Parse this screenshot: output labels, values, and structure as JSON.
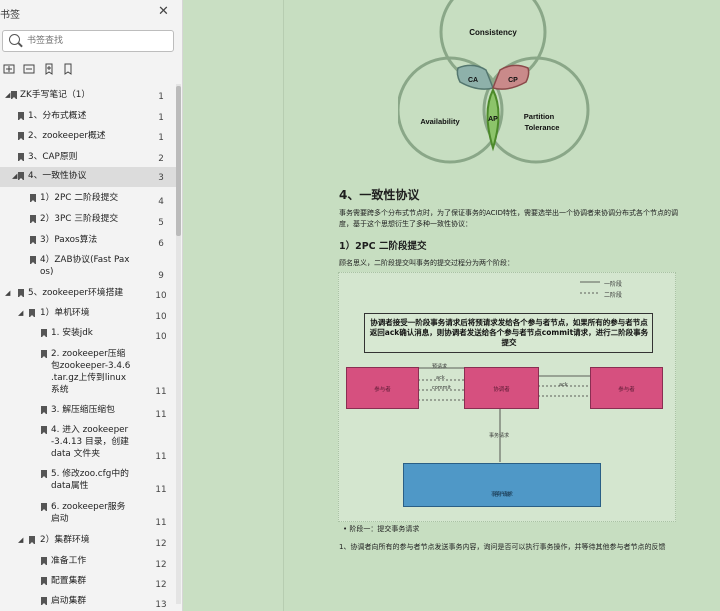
{
  "sidebar": {
    "title": "书签",
    "search_placeholder": "书签查找",
    "items": [
      {
        "label": "ZK手写笔记（1）",
        "page": "1"
      },
      {
        "label": "1、分布式概述",
        "page": "1"
      },
      {
        "label": "2、zookeeper概述",
        "page": "1"
      },
      {
        "label": "3、CAP原则",
        "page": "2"
      },
      {
        "label": "4、一致性协议",
        "page": "3"
      },
      {
        "label": "1）2PC 二阶段提交",
        "page": "4"
      },
      {
        "label": "2）3PC 三阶段提交",
        "page": "5"
      },
      {
        "label": "3）Paxos算法",
        "page": "6"
      },
      {
        "label": "4）ZAB协议(Fast Pax",
        "label2": "os)",
        "page": "9"
      },
      {
        "label": "5、zookeeper环境搭建",
        "page": "10"
      },
      {
        "label": "1）单机环境",
        "page": "10"
      },
      {
        "label": "1. 安装jdk",
        "page": "10"
      },
      {
        "label": "2. zookeeper压缩",
        "label2": "包zookeeper-3.4.6",
        "label3": ".tar.gz上传到linux",
        "label4": "系统",
        "page": "11"
      },
      {
        "label": "3. 解压缩压缩包",
        "page": "11"
      },
      {
        "label": "4. 进入 zookeeper",
        "label2": "-3.4.13 目录，创建",
        "label3": "data 文件夹",
        "page": "11"
      },
      {
        "label": "5. 修改zoo.cfg中的",
        "label2": "data属性",
        "page": "11"
      },
      {
        "label": "6. zookeeper服务",
        "label2": "启动",
        "page": "11"
      },
      {
        "label": "2）集群环境",
        "page": "12"
      },
      {
        "label": "准备工作",
        "page": "12"
      },
      {
        "label": "配置集群",
        "page": "12"
      },
      {
        "label": "启动集群",
        "page": "13"
      }
    ]
  },
  "venn": {
    "consistency": "Consistency",
    "availability": "Availability",
    "partition": "Partition",
    "tolerance": "Tolerance",
    "ca": "CA",
    "cp": "CP",
    "ap": "AP"
  },
  "doc": {
    "heading": "4、一致性协议",
    "para1": "事务需要跨多个分布式节点时，为了保证事务的ACID特性，需要选举出一个协调者来协调分布式各个节点的调度，基于这个思想衍生了多种一致性协议：",
    "sub1": "1）2PC 二阶段提交",
    "para2": "顾名思义，二阶段提交叫事务的提交过程分为两个阶段：",
    "legend1": "一阶段",
    "legend2": "二阶段",
    "note": "协调者接受一阶段事务请求后将预请求发给各个参与者节点，如果所有的参与者节点返回ack确认消息，则协调者发送给各个参与者节点commit请求，进行二阶段事务提交",
    "left_box": "参与者",
    "mid_box": "协调者",
    "right_box": "参与者",
    "bottom_box1": "事务请求",
    "bottom_box2": "客户端",
    "lbl_pre": "预请求",
    "lbl_ack": "ack",
    "lbl_commit": "commit",
    "lbl_ack2": "ack",
    "lbl_req": "事务请求",
    "bullet": "阶段一：提交事务请求",
    "para3": "1、协调者向所有的参与者节点发送事务内容，询问是否可以执行事务操作，并等待其他参与者节点的反馈"
  },
  "colors": {
    "sidebar_bg": "#f3f3f3",
    "page_bg": "#c9dfc3",
    "pink": "#d6507f",
    "blue": "#4f98c7"
  }
}
